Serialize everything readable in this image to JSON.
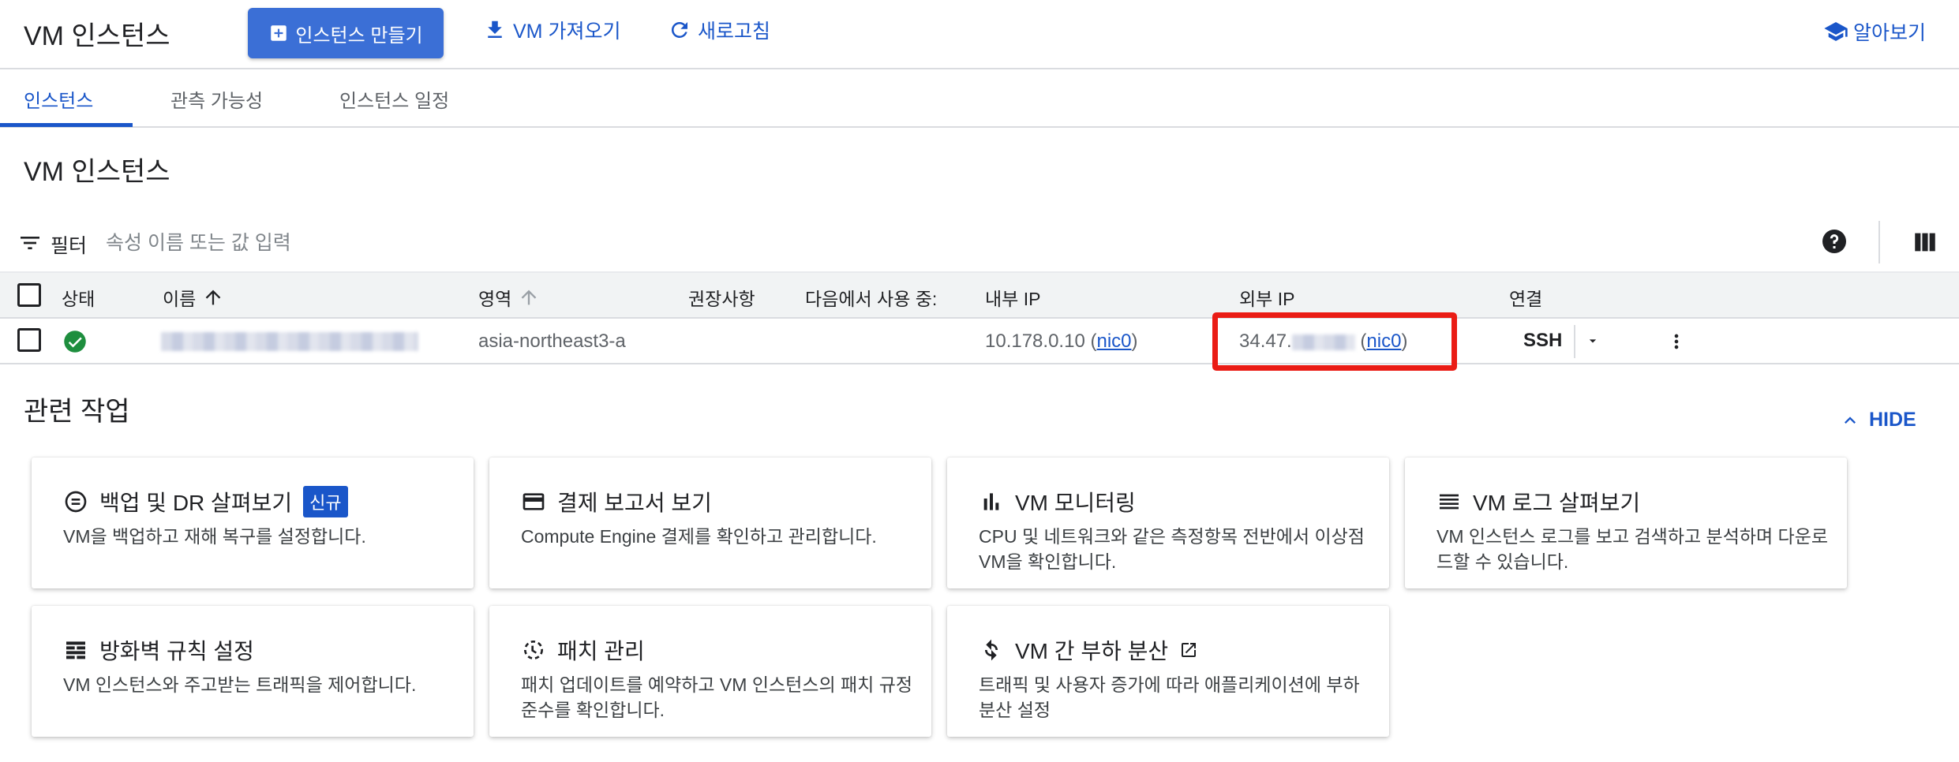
{
  "header": {
    "title": "VM 인스턴스",
    "create_label": "인스턴스 만들기",
    "import_label": "VM 가져오기",
    "refresh_label": "새로고침",
    "learn_label": "알아보기"
  },
  "tabs": [
    {
      "label": "인스턴스"
    },
    {
      "label": "관측 가능성"
    },
    {
      "label": "인스턴스 일정"
    }
  ],
  "section_title": "VM 인스턴스",
  "filter": {
    "label": "필터",
    "placeholder": "속성 이름 또는 값 입력"
  },
  "table": {
    "headers": {
      "status": "상태",
      "name": "이름",
      "zone": "영역",
      "recommendation": "권장사항",
      "in_use_by": "다음에서 사용 중:",
      "internal_ip": "내부 IP",
      "external_ip": "외부 IP",
      "connect": "연결"
    },
    "rows": [
      {
        "zone": "asia-northeast3-a",
        "internal_ip": "10.178.0.10",
        "internal_nic": "nic0",
        "external_ip_prefix": "34.47.",
        "external_nic": "nic0",
        "connect": "SSH"
      }
    ]
  },
  "related": {
    "title": "관련 작업",
    "hide_label": "HIDE",
    "cards": [
      {
        "title": "백업 및 DR 살펴보기",
        "badge": "신규",
        "desc": "VM을 백업하고 재해 복구를 설정합니다.",
        "icon": "backup-icon"
      },
      {
        "title": "결제 보고서 보기",
        "desc": "Compute Engine 결제를 확인하고 관리합니다.",
        "icon": "billing-icon"
      },
      {
        "title": "VM 모니터링",
        "desc": "CPU 및 네트워크와 같은 측정항목 전반에서 이상점 VM을 확인합니다.",
        "icon": "bar-chart-icon"
      },
      {
        "title": "VM 로그 살펴보기",
        "desc": "VM 인스턴스 로그를 보고 검색하고 분석하며 다운로드할 수 있습니다.",
        "icon": "logs-icon"
      },
      {
        "title": "방화벽 규칙 설정",
        "desc": "VM 인스턴스와 주고받는 트래픽을 제어합니다.",
        "icon": "firewall-icon"
      },
      {
        "title": "패치 관리",
        "desc": "패치 업데이트를 예약하고 VM 인스턴스의 패치 규정 준수를 확인합니다.",
        "icon": "patch-icon"
      },
      {
        "title": "VM 간 부하 분산",
        "desc": "트래픽 및 사용자 증가에 따라 애플리케이션에 부하 분산 설정",
        "icon": "load-balance-icon"
      }
    ]
  },
  "colors": {
    "accent": "#1a56c9",
    "primary_button": "#3b6fd6",
    "status_ok": "#1e8e3e",
    "highlight": "#ea1c15"
  }
}
